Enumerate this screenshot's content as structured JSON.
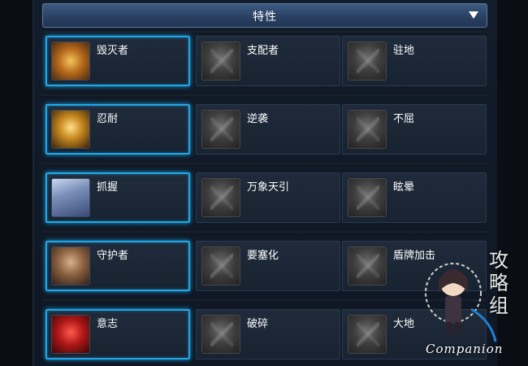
{
  "header": {
    "title": "特性"
  },
  "rows": [
    [
      {
        "label": "毁灭者",
        "active": true,
        "icon": "destroyer-icon"
      },
      {
        "label": "支配者",
        "active": false,
        "icon": "dominator-icon"
      },
      {
        "label": "驻地",
        "active": false,
        "icon": "garrison-icon"
      }
    ],
    [
      {
        "label": "忍耐",
        "active": true,
        "icon": "endure-icon"
      },
      {
        "label": "逆袭",
        "active": false,
        "icon": "counterattack-icon"
      },
      {
        "label": "不屈",
        "active": false,
        "icon": "unyielding-icon"
      }
    ],
    [
      {
        "label": "抓握",
        "active": true,
        "icon": "grasp-icon"
      },
      {
        "label": "万象天引",
        "active": false,
        "icon": "gravity-pull-icon"
      },
      {
        "label": "眩晕",
        "active": false,
        "icon": "stun-icon"
      }
    ],
    [
      {
        "label": "守护者",
        "active": true,
        "icon": "guardian-icon"
      },
      {
        "label": "要塞化",
        "active": false,
        "icon": "fortify-icon"
      },
      {
        "label": "盾牌加击",
        "active": false,
        "icon": "shield-bash-icon"
      }
    ],
    [
      {
        "label": "意志",
        "active": true,
        "icon": "will-icon"
      },
      {
        "label": "破碎",
        "active": false,
        "icon": "shatter-icon"
      },
      {
        "label": "大地",
        "active": false,
        "icon": "earth-icon"
      }
    ]
  ],
  "watermark": {
    "text": "Companion",
    "chars": "攻略组"
  },
  "colors": {
    "active_border": "#1ea8e8",
    "header": "#2a4163"
  }
}
